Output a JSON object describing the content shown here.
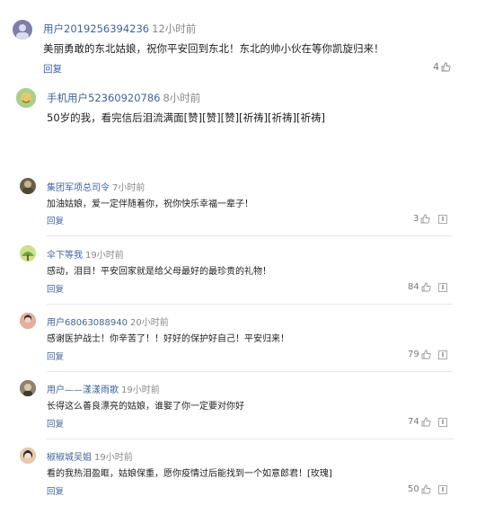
{
  "comments": [
    {
      "user": "用户2019256394236",
      "time": "12小时前",
      "text": "美丽勇敢的东北姑娘，祝你平安回到东北！东北的帅小伙在等你凯旋归来！",
      "reply": "回复",
      "likes": "4",
      "avatar_color": "#7d7fa8"
    },
    {
      "user": "手机用户52360920786",
      "time": "8小时前",
      "text": "50岁的我，看完信后泪流满面[赞][赞][赞][祈祷][祈祷][祈祷]",
      "avatar_color": "#9cc67a"
    },
    {
      "user": "集团军项总司令",
      "time": "7小时前",
      "text": "加油姑娘，爱一定伴随着你，祝你快乐幸福一辈子！",
      "reply": "回复",
      "likes": "3",
      "avatar_color": "#6a6048"
    },
    {
      "user": "伞下等我",
      "time": "19小时前",
      "text": "感动，泪目！平安回家就是给父母最好的最珍贵的礼物！",
      "reply": "回复",
      "likes": "84",
      "avatar_color": "#b5c86a"
    },
    {
      "user": "用户68063088940",
      "time": "20小时前",
      "text": "感谢医护战士！你辛苦了！！好好的保护好自己！平安归来！",
      "reply": "回复",
      "likes": "79",
      "avatar_color": "#d08f7c"
    },
    {
      "user": "用户——漾漾雨歌",
      "time": "19小时前",
      "text": "长得这么善良漂亮的姑娘，谁娶了你一定要对你好",
      "reply": "回复",
      "likes": "74",
      "avatar_color": "#6b6656"
    },
    {
      "user": "椒椒城吴姐",
      "time": "19小时前",
      "text": "看的我热泪盈眶，姑娘保重，愿你疫情过后能找到一个如意郎君！[玫瑰]",
      "reply": "回复",
      "likes": "50",
      "avatar_color": "#c9a07c"
    }
  ]
}
